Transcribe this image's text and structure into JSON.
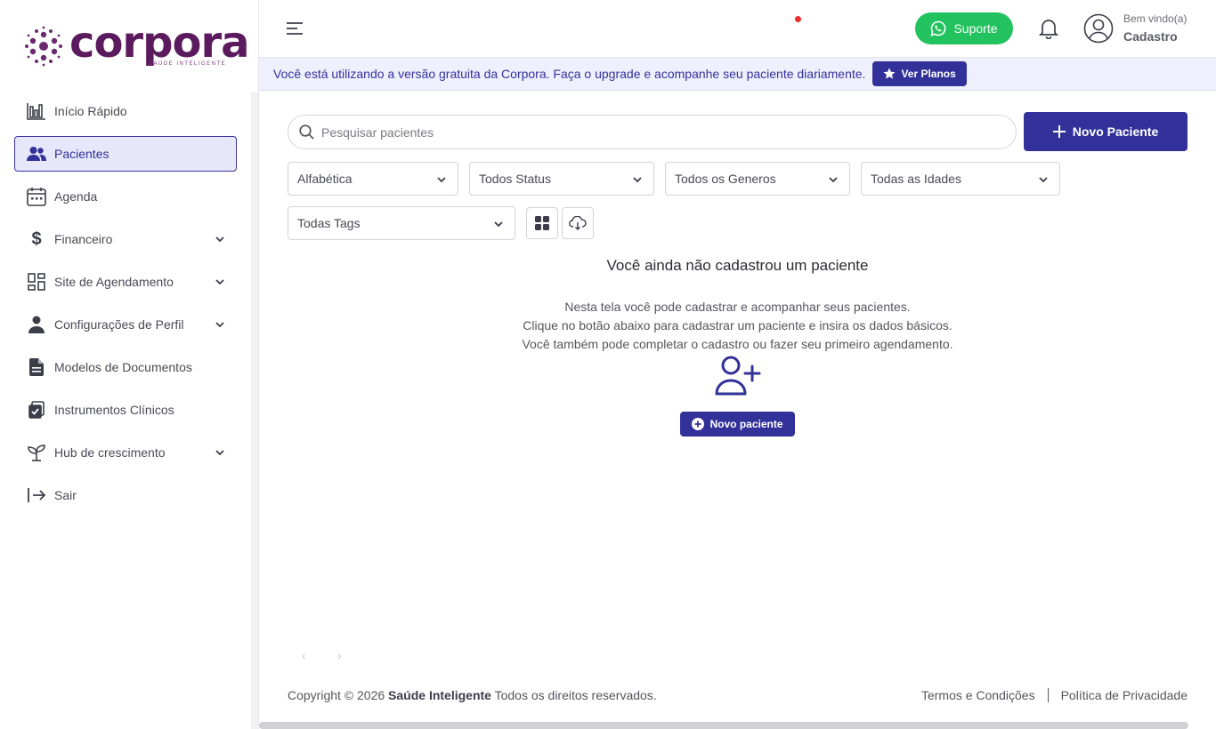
{
  "app": {
    "logo_text": "corpora",
    "logo_tagline": "SAÚDE INTELIGENTE",
    "brand_color": "#32319a",
    "logo_color": "#5b1a5e"
  },
  "sidebar": {
    "items": [
      {
        "label": "Início Rápido",
        "icon": "bar-chart-icon"
      },
      {
        "label": "Pacientes",
        "icon": "users-icon",
        "active": true
      },
      {
        "label": "Agenda",
        "icon": "calendar-icon"
      },
      {
        "label": "Financeiro",
        "icon": "dollar-icon",
        "expandable": true
      },
      {
        "label": "Site de Agendamento",
        "icon": "dashboard-icon",
        "expandable": true
      },
      {
        "label": "Configurações de Perfil",
        "icon": "user-icon",
        "expandable": true
      },
      {
        "label": "Modelos de Documentos",
        "icon": "document-icon"
      },
      {
        "label": "Instrumentos Clínicos",
        "icon": "clipboard-icon"
      },
      {
        "label": "Hub de crescimento",
        "icon": "sprout-icon",
        "expandable": true
      },
      {
        "label": "Sair",
        "icon": "logout-icon"
      }
    ]
  },
  "header": {
    "support_label": "Suporte",
    "support_color": "#22c35e",
    "welcome": "Bem vindo(a)",
    "user_name": "Cadastro"
  },
  "banner": {
    "text": "Você está utilizando a versão gratuita da Corpora. Faça o upgrade e acompanhe seu paciente diariamente.",
    "button_label": "Ver Planos"
  },
  "main": {
    "search_placeholder": "Pesquisar pacientes",
    "new_patient_label": "Novo Paciente",
    "filters": {
      "sort": "Alfabética",
      "status": "Todos Status",
      "gender": "Todos os Generos",
      "age": "Todas as Idades",
      "tags": "Todas Tags"
    },
    "empty": {
      "title": "Você ainda não cadastrou um paciente",
      "line1": "Nesta tela você pode cadastrar e acompanhar seus pacientes.",
      "line2": "Clique no botão abaixo para cadastrar um paciente e insira os dados básicos.",
      "line3": "Você também pode completar o cadastro ou fazer seu primeiro agendamento.",
      "button_label": "Novo paciente"
    },
    "pager": {
      "prev": "‹",
      "next": "›"
    }
  },
  "footer": {
    "copyright_prefix": "Copyright © 2026",
    "company": "Saúde Inteligente",
    "rights": "Todos os direitos reservados.",
    "terms": "Termos e Condições",
    "privacy": "Política de Privacidade"
  }
}
